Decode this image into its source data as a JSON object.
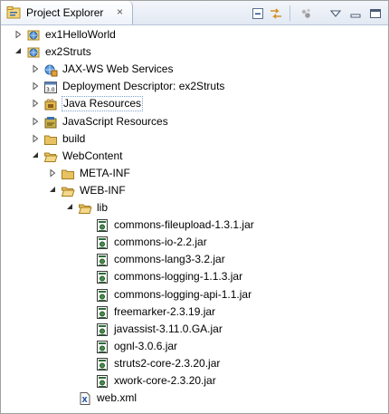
{
  "view": {
    "title": "Project Explorer",
    "close_glyph": "×",
    "icons": [
      "project-explorer-icon",
      "collapse-all-icon",
      "link-with-editor-icon",
      "filter-icon",
      "view-menu-icon",
      "minimize-icon",
      "maximize-icon"
    ]
  },
  "tree": [
    {
      "label": "ex1HelloWorld",
      "icon": "web-project-icon",
      "level": 0,
      "state": "collapsed"
    },
    {
      "label": "ex2Struts",
      "icon": "web-project-icon",
      "level": 0,
      "state": "expanded"
    },
    {
      "label": "JAX-WS Web Services",
      "icon": "web-services-icon",
      "level": 1,
      "state": "collapsed"
    },
    {
      "label": "Deployment Descriptor: ex2Struts",
      "icon": "deployment-descriptor-icon",
      "level": 1,
      "state": "collapsed"
    },
    {
      "label": "Java Resources",
      "icon": "java-resources-icon",
      "level": 1,
      "state": "collapsed",
      "selected": true
    },
    {
      "label": "JavaScript Resources",
      "icon": "javascript-resources-icon",
      "level": 1,
      "state": "collapsed"
    },
    {
      "label": "build",
      "icon": "folder-icon",
      "level": 1,
      "state": "collapsed"
    },
    {
      "label": "WebContent",
      "icon": "folder-open-icon",
      "level": 1,
      "state": "expanded"
    },
    {
      "label": "META-INF",
      "icon": "folder-icon",
      "level": 2,
      "state": "collapsed"
    },
    {
      "label": "WEB-INF",
      "icon": "folder-open-icon",
      "level": 2,
      "state": "expanded"
    },
    {
      "label": "lib",
      "icon": "folder-open-icon",
      "level": 3,
      "state": "expanded"
    },
    {
      "label": "commons-fileupload-1.3.1.jar",
      "icon": "jar-icon",
      "level": 4,
      "state": "leaf"
    },
    {
      "label": "commons-io-2.2.jar",
      "icon": "jar-icon",
      "level": 4,
      "state": "leaf"
    },
    {
      "label": "commons-lang3-3.2.jar",
      "icon": "jar-icon",
      "level": 4,
      "state": "leaf"
    },
    {
      "label": "commons-logging-1.1.3.jar",
      "icon": "jar-icon",
      "level": 4,
      "state": "leaf"
    },
    {
      "label": "commons-logging-api-1.1.jar",
      "icon": "jar-icon",
      "level": 4,
      "state": "leaf"
    },
    {
      "label": "freemarker-2.3.19.jar",
      "icon": "jar-icon",
      "level": 4,
      "state": "leaf"
    },
    {
      "label": "javassist-3.11.0.GA.jar",
      "icon": "jar-icon",
      "level": 4,
      "state": "leaf"
    },
    {
      "label": "ognl-3.0.6.jar",
      "icon": "jar-icon",
      "level": 4,
      "state": "leaf"
    },
    {
      "label": "struts2-core-2.3.20.jar",
      "icon": "jar-icon",
      "level": 4,
      "state": "leaf"
    },
    {
      "label": "xwork-core-2.3.20.jar",
      "icon": "jar-icon",
      "level": 4,
      "state": "leaf"
    },
    {
      "label": "web.xml",
      "icon": "xml-file-icon",
      "level": 3,
      "state": "leaf"
    }
  ],
  "colors": {
    "folder": "#e8c261",
    "selection_border": "#7da2ce",
    "tab_bg": "#eef3fa"
  }
}
